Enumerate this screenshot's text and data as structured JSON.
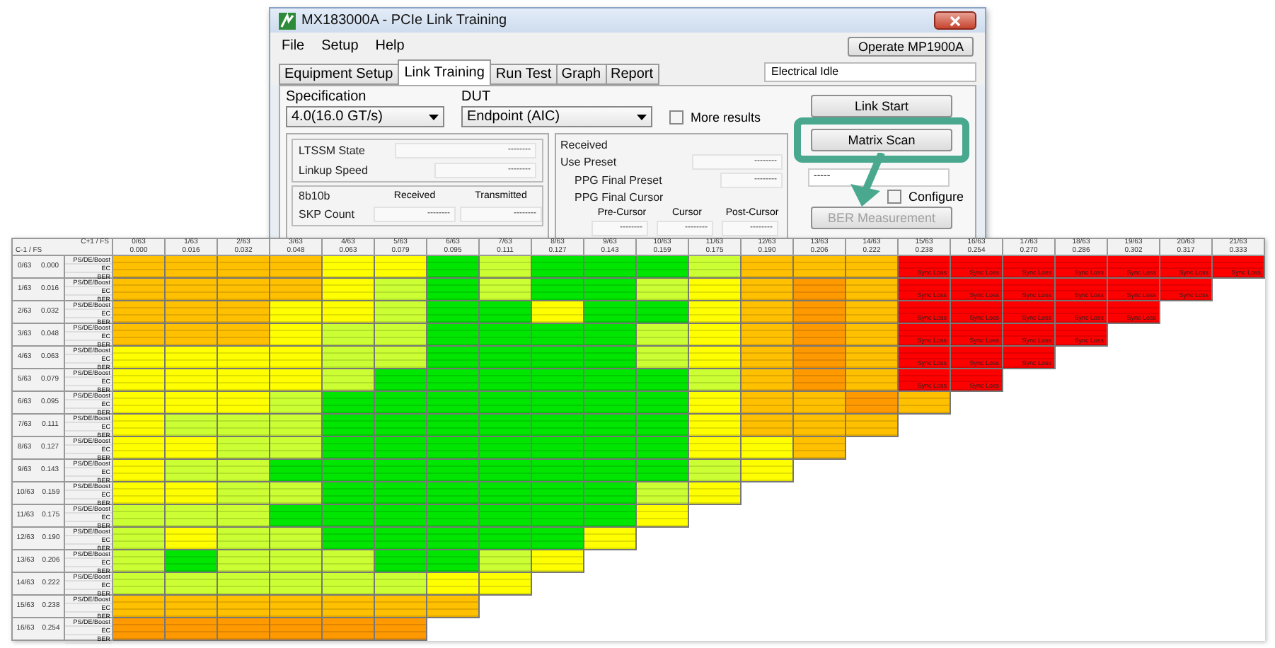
{
  "window": {
    "title": "MX183000A - PCIe Link Training",
    "menu": [
      "File",
      "Setup",
      "Help"
    ],
    "operate_button": "Operate MP1900A",
    "tabs": [
      {
        "label": "Equipment Setup",
        "selected": false
      },
      {
        "label": "Link Training",
        "selected": true
      },
      {
        "label": "Run Test",
        "selected": false
      },
      {
        "label": "Graph",
        "selected": false
      },
      {
        "label": "Report",
        "selected": false
      }
    ],
    "status_field": "Electrical Idle",
    "specification": {
      "label": "Specification",
      "value": "4.0(16.0 GT/s)"
    },
    "dut": {
      "label": "DUT",
      "value": "Endpoint (AIC)"
    },
    "more_results": {
      "label": "More results",
      "checked": false
    },
    "link_panel": [
      {
        "label": "LTSSM State",
        "value": "--------"
      },
      {
        "label": "Linkup Speed",
        "value": "--------"
      }
    ],
    "encoding_panel": {
      "title": "8b10b",
      "columns": [
        "Received",
        "Transmitted"
      ],
      "rows": [
        {
          "label": "SKP Count",
          "values": [
            "--------",
            "--------"
          ]
        }
      ]
    },
    "received_panel": {
      "title": "Received",
      "use_preset": {
        "label": "Use Preset",
        "value": "--------"
      },
      "final_preset": {
        "label": "PPG Final Preset",
        "value": "--------"
      },
      "final_cursor": {
        "label": "PPG Final Cursor",
        "columns": [
          "Pre-Cursor",
          "Cursor",
          "Post-Cursor"
        ],
        "values": [
          "--------",
          "--------",
          "--------"
        ]
      }
    },
    "side": {
      "link_start": "Link Start",
      "matrix_scan": "Matrix Scan",
      "field_value": "-----",
      "configure": {
        "label": "Configure",
        "checked": false
      },
      "ber_button": {
        "label": "BER Measurement",
        "disabled": true
      }
    }
  },
  "matrix": {
    "corner_top": "C+1 / FS",
    "corner_side": "C-1 / FS",
    "columns": [
      {
        "label": "0/63",
        "value": "0.000"
      },
      {
        "label": "1/63",
        "value": "0.016"
      },
      {
        "label": "2/63",
        "value": "0.032"
      },
      {
        "label": "3/63",
        "value": "0.048"
      },
      {
        "label": "4/63",
        "value": "0.063"
      },
      {
        "label": "5/63",
        "value": "0.079"
      },
      {
        "label": "6/63",
        "value": "0.095"
      },
      {
        "label": "7/63",
        "value": "0.111"
      },
      {
        "label": "8/63",
        "value": "0.127"
      },
      {
        "label": "9/63",
        "value": "0.143"
      },
      {
        "label": "10/63",
        "value": "0.159"
      },
      {
        "label": "11/63",
        "value": "0.175"
      },
      {
        "label": "12/63",
        "value": "0.190"
      },
      {
        "label": "13/63",
        "value": "0.206"
      },
      {
        "label": "14/63",
        "value": "0.222"
      },
      {
        "label": "15/63",
        "value": "0.238"
      },
      {
        "label": "16/63",
        "value": "0.254"
      },
      {
        "label": "17/63",
        "value": "0.270"
      },
      {
        "label": "18/63",
        "value": "0.286"
      },
      {
        "label": "19/63",
        "value": "0.302"
      },
      {
        "label": "20/63",
        "value": "0.317"
      },
      {
        "label": "21/63",
        "value": "0.333"
      }
    ],
    "rows": [
      {
        "label": "0/63",
        "value": "0.000",
        "sub_labels": [
          "PS/DE/Boost",
          "EC",
          "BER"
        ],
        "cells": [
          {
            "color": "#ffc000"
          },
          {
            "color": "#ffc000"
          },
          {
            "color": "#ffc000"
          },
          {
            "color": "#ffc000"
          },
          {
            "color": "#ffff00"
          },
          {
            "color": "#ffff00"
          },
          {
            "color": "#00e600"
          },
          {
            "color": "#ccff33"
          },
          {
            "color": "#00e600"
          },
          {
            "color": "#00e600"
          },
          {
            "color": "#00e600"
          },
          {
            "color": "#ccff33"
          },
          {
            "color": "#ffc000"
          },
          {
            "color": "#ffc000"
          },
          {
            "color": "#ffc000"
          },
          {
            "color": "#ff0000",
            "ber": "Sync Loss"
          },
          {
            "color": "#ff0000",
            "ber": "Sync Loss"
          },
          {
            "color": "#ff0000",
            "ber": "Sync Loss"
          },
          {
            "color": "#ff0000",
            "ber": "Sync Loss"
          },
          {
            "color": "#ff0000",
            "ber": "Sync Loss"
          },
          {
            "color": "#ff0000",
            "ber": "Sync Loss"
          },
          {
            "color": "#ff0000",
            "ber": "Sync Loss"
          }
        ]
      },
      {
        "label": "1/63",
        "value": "0.016",
        "sub_labels": [
          "PS/DE/Boost",
          "EC",
          "BER"
        ],
        "cells": [
          {
            "color": "#ffc000"
          },
          {
            "color": "#ffc000"
          },
          {
            "color": "#ffc000"
          },
          {
            "color": "#ffc000"
          },
          {
            "color": "#ffff00"
          },
          {
            "color": "#ccff33"
          },
          {
            "color": "#00e600"
          },
          {
            "color": "#ccff33"
          },
          {
            "color": "#00e600"
          },
          {
            "color": "#00e600"
          },
          {
            "color": "#ccff33"
          },
          {
            "color": "#ffff00"
          },
          {
            "color": "#ffc000"
          },
          {
            "color": "#ff9900"
          },
          {
            "color": "#ffc000"
          },
          {
            "color": "#ff0000",
            "ber": "Sync Loss"
          },
          {
            "color": "#ff0000",
            "ber": "Sync Loss"
          },
          {
            "color": "#ff0000",
            "ber": "Sync Loss"
          },
          {
            "color": "#ff0000",
            "ber": "Sync Loss"
          },
          {
            "color": "#ff0000",
            "ber": "Sync Loss"
          },
          {
            "color": "#ff0000",
            "ber": "Sync Loss"
          }
        ]
      },
      {
        "label": "2/63",
        "value": "0.032",
        "sub_labels": [
          "PS/DE/Boost",
          "EC",
          "BER"
        ],
        "cells": [
          {
            "color": "#ffc000"
          },
          {
            "color": "#ffc000"
          },
          {
            "color": "#ffc000"
          },
          {
            "color": "#ffff00"
          },
          {
            "color": "#ffff00"
          },
          {
            "color": "#ccff33"
          },
          {
            "color": "#00e600"
          },
          {
            "color": "#00e600"
          },
          {
            "color": "#ffff00"
          },
          {
            "color": "#00e600"
          },
          {
            "color": "#00e600"
          },
          {
            "color": "#ffff00"
          },
          {
            "color": "#ffc000"
          },
          {
            "color": "#ff9900"
          },
          {
            "color": "#ffc000"
          },
          {
            "color": "#ff0000",
            "ber": "Sync Loss"
          },
          {
            "color": "#ff0000",
            "ber": "Sync Loss"
          },
          {
            "color": "#ff0000",
            "ber": "Sync Loss"
          },
          {
            "color": "#ff0000",
            "ber": "Sync Loss"
          },
          {
            "color": "#ff0000",
            "ber": "Sync Loss"
          }
        ]
      },
      {
        "label": "3/63",
        "value": "0.048",
        "sub_labels": [
          "PS/DE/Boost",
          "EC",
          "BER"
        ],
        "cells": [
          {
            "color": "#ffc000"
          },
          {
            "color": "#ffc000"
          },
          {
            "color": "#ffc000"
          },
          {
            "color": "#ffff00"
          },
          {
            "color": "#ccff33"
          },
          {
            "color": "#ccff33"
          },
          {
            "color": "#00e600"
          },
          {
            "color": "#00e600"
          },
          {
            "color": "#00e600"
          },
          {
            "color": "#00e600"
          },
          {
            "color": "#ccff33"
          },
          {
            "color": "#ffff00"
          },
          {
            "color": "#ffc000"
          },
          {
            "color": "#ff9900"
          },
          {
            "color": "#ffc000"
          },
          {
            "color": "#ff0000",
            "ber": "Sync Loss"
          },
          {
            "color": "#ff0000",
            "ber": "Sync Loss"
          },
          {
            "color": "#ff0000",
            "ber": "Sync Loss"
          },
          {
            "color": "#ff0000",
            "ber": "Sync Loss"
          }
        ]
      },
      {
        "label": "4/63",
        "value": "0.063",
        "sub_labels": [
          "PS/DE/Boost",
          "EC",
          "BER"
        ],
        "cells": [
          {
            "color": "#ffff00"
          },
          {
            "color": "#ffff00"
          },
          {
            "color": "#ffff00"
          },
          {
            "color": "#ffff00"
          },
          {
            "color": "#ccff33"
          },
          {
            "color": "#ccff33"
          },
          {
            "color": "#00e600"
          },
          {
            "color": "#00e600"
          },
          {
            "color": "#00e600"
          },
          {
            "color": "#00e600"
          },
          {
            "color": "#ccff33"
          },
          {
            "color": "#ffff00"
          },
          {
            "color": "#ffc000"
          },
          {
            "color": "#ff9900"
          },
          {
            "color": "#ffc000"
          },
          {
            "color": "#ff0000",
            "ber": "Sync Loss"
          },
          {
            "color": "#ff0000",
            "ber": "Sync Loss"
          },
          {
            "color": "#ff0000",
            "ber": "Sync Loss"
          }
        ]
      },
      {
        "label": "5/63",
        "value": "0.079",
        "sub_labels": [
          "PS/DE/Boost",
          "EC",
          "BER"
        ],
        "cells": [
          {
            "color": "#ffff00"
          },
          {
            "color": "#ffff00"
          },
          {
            "color": "#ffff00"
          },
          {
            "color": "#ffff00"
          },
          {
            "color": "#ccff33"
          },
          {
            "color": "#00e600"
          },
          {
            "color": "#00e600"
          },
          {
            "color": "#00e600"
          },
          {
            "color": "#00e600"
          },
          {
            "color": "#00e600"
          },
          {
            "color": "#00e600"
          },
          {
            "color": "#ccff33"
          },
          {
            "color": "#ffc000"
          },
          {
            "color": "#ff9900"
          },
          {
            "color": "#ffc000"
          },
          {
            "color": "#ff0000",
            "ber": "Sync Loss"
          },
          {
            "color": "#ff0000",
            "ber": "Sync Loss"
          }
        ]
      },
      {
        "label": "6/63",
        "value": "0.095",
        "sub_labels": [
          "PS/DE/Boost",
          "EC",
          "BER"
        ],
        "cells": [
          {
            "color": "#ffff00"
          },
          {
            "color": "#ffff00"
          },
          {
            "color": "#ffff00"
          },
          {
            "color": "#ccff33"
          },
          {
            "color": "#00e600"
          },
          {
            "color": "#00e600"
          },
          {
            "color": "#00e600"
          },
          {
            "color": "#00e600"
          },
          {
            "color": "#00e600"
          },
          {
            "color": "#00e600"
          },
          {
            "color": "#00e600"
          },
          {
            "color": "#ffff00"
          },
          {
            "color": "#ffc000"
          },
          {
            "color": "#ffc000"
          },
          {
            "color": "#ff9900"
          },
          {
            "color": "#ffc000"
          }
        ]
      },
      {
        "label": "7/63",
        "value": "0.111",
        "sub_labels": [
          "PS/DE/Boost",
          "EC",
          "BER"
        ],
        "cells": [
          {
            "color": "#ffff00"
          },
          {
            "color": "#ccff33"
          },
          {
            "color": "#ccff33"
          },
          {
            "color": "#ccff33"
          },
          {
            "color": "#00e600"
          },
          {
            "color": "#00e600"
          },
          {
            "color": "#00e600"
          },
          {
            "color": "#00e600"
          },
          {
            "color": "#00e600"
          },
          {
            "color": "#00e600"
          },
          {
            "color": "#00e600"
          },
          {
            "color": "#ffff00"
          },
          {
            "color": "#ffc000"
          },
          {
            "color": "#ffc000"
          },
          {
            "color": "#ffc000"
          }
        ]
      },
      {
        "label": "8/63",
        "value": "0.127",
        "sub_labels": [
          "PS/DE/Boost",
          "EC",
          "BER"
        ],
        "cells": [
          {
            "color": "#ffff00"
          },
          {
            "color": "#ffff00"
          },
          {
            "color": "#ccff33"
          },
          {
            "color": "#ccff33"
          },
          {
            "color": "#00e600"
          },
          {
            "color": "#00e600"
          },
          {
            "color": "#00e600"
          },
          {
            "color": "#00e600"
          },
          {
            "color": "#00e600"
          },
          {
            "color": "#00e600"
          },
          {
            "color": "#00e600"
          },
          {
            "color": "#ffff00"
          },
          {
            "color": "#ffff00"
          },
          {
            "color": "#ffc000"
          }
        ]
      },
      {
        "label": "9/63",
        "value": "0.143",
        "sub_labels": [
          "PS/DE/Boost",
          "EC",
          "BER"
        ],
        "cells": [
          {
            "color": "#ffff00"
          },
          {
            "color": "#ccff33"
          },
          {
            "color": "#ccff33"
          },
          {
            "color": "#00e600"
          },
          {
            "color": "#00e600"
          },
          {
            "color": "#00e600"
          },
          {
            "color": "#00e600"
          },
          {
            "color": "#00e600"
          },
          {
            "color": "#00e600"
          },
          {
            "color": "#00e600"
          },
          {
            "color": "#00e600"
          },
          {
            "color": "#ccff33"
          },
          {
            "color": "#ffff00"
          }
        ]
      },
      {
        "label": "10/63",
        "value": "0.159",
        "sub_labels": [
          "PS/DE/Boost",
          "EC",
          "BER"
        ],
        "cells": [
          {
            "color": "#ffff00"
          },
          {
            "color": "#ffff00"
          },
          {
            "color": "#ccff33"
          },
          {
            "color": "#ccff33"
          },
          {
            "color": "#00e600"
          },
          {
            "color": "#00e600"
          },
          {
            "color": "#00e600"
          },
          {
            "color": "#00e600"
          },
          {
            "color": "#00e600"
          },
          {
            "color": "#00e600"
          },
          {
            "color": "#ccff33"
          },
          {
            "color": "#ffff00"
          }
        ]
      },
      {
        "label": "11/63",
        "value": "0.175",
        "sub_labels": [
          "PS/DE/Boost",
          "EC",
          "BER"
        ],
        "cells": [
          {
            "color": "#ccff33"
          },
          {
            "color": "#ccff33"
          },
          {
            "color": "#ccff33"
          },
          {
            "color": "#00e600"
          },
          {
            "color": "#00e600"
          },
          {
            "color": "#00e600"
          },
          {
            "color": "#00e600"
          },
          {
            "color": "#00e600"
          },
          {
            "color": "#00e600"
          },
          {
            "color": "#00e600"
          },
          {
            "color": "#ffff00"
          }
        ]
      },
      {
        "label": "12/63",
        "value": "0.190",
        "sub_labels": [
          "PS/DE/Boost",
          "EC",
          "BER"
        ],
        "cells": [
          {
            "color": "#ccff33"
          },
          {
            "color": "#ffff00"
          },
          {
            "color": "#ccff33"
          },
          {
            "color": "#ccff33"
          },
          {
            "color": "#00e600"
          },
          {
            "color": "#00e600"
          },
          {
            "color": "#00e600"
          },
          {
            "color": "#00e600"
          },
          {
            "color": "#00e600"
          },
          {
            "color": "#ffff00"
          }
        ]
      },
      {
        "label": "13/63",
        "value": "0.206",
        "sub_labels": [
          "PS/DE/Boost",
          "EC",
          "BER"
        ],
        "cells": [
          {
            "color": "#ccff33"
          },
          {
            "color": "#00e600"
          },
          {
            "color": "#ccff33"
          },
          {
            "color": "#ccff33"
          },
          {
            "color": "#ccff33"
          },
          {
            "color": "#00e600"
          },
          {
            "color": "#00e600"
          },
          {
            "color": "#ccff33"
          },
          {
            "color": "#ffff00"
          }
        ]
      },
      {
        "label": "14/63",
        "value": "0.222",
        "sub_labels": [
          "PS/DE/Boost",
          "EC",
          "BER"
        ],
        "cells": [
          {
            "color": "#ccff33"
          },
          {
            "color": "#ccff33"
          },
          {
            "color": "#ccff33"
          },
          {
            "color": "#ccff33"
          },
          {
            "color": "#ccff33"
          },
          {
            "color": "#ccff33"
          },
          {
            "color": "#ffff00"
          },
          {
            "color": "#ffff00"
          }
        ]
      },
      {
        "label": "15/63",
        "value": "0.238",
        "sub_labels": [
          "PS/DE/Boost",
          "EC",
          "BER"
        ],
        "cells": [
          {
            "color": "#ffc000"
          },
          {
            "color": "#ffc000"
          },
          {
            "color": "#ffc000"
          },
          {
            "color": "#ffc000"
          },
          {
            "color": "#ffc000"
          },
          {
            "color": "#ffc000"
          },
          {
            "color": "#ffc000"
          }
        ]
      },
      {
        "label": "16/63",
        "value": "0.254",
        "sub_labels": [
          "PS/DE/Boost",
          "EC",
          "BER"
        ],
        "cells": [
          {
            "color": "#ff9900"
          },
          {
            "color": "#ff9900"
          },
          {
            "color": "#ff9900"
          },
          {
            "color": "#ff9900"
          },
          {
            "color": "#ff9900"
          },
          {
            "color": "#ff9900"
          }
        ]
      }
    ]
  }
}
